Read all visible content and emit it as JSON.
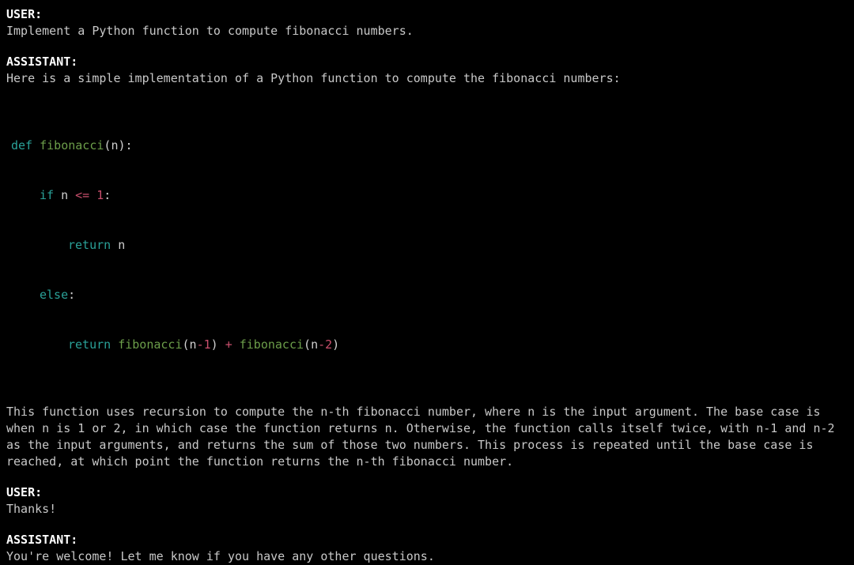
{
  "turns": [
    {
      "speaker": "USER:",
      "text": "Implement a Python function to compute fibonacci numbers."
    },
    {
      "speaker": "ASSISTANT:",
      "text": "Here is a simple implementation of a Python function to compute the fibonacci numbers:"
    }
  ],
  "code": {
    "line1": {
      "def": "def ",
      "fn": "fibonacci",
      "open": "(",
      "arg": "n",
      "close": "):"
    },
    "line2": {
      "if": "if ",
      "var": "n ",
      "op": "<= ",
      "num": "1",
      "colon": ":"
    },
    "line3": {
      "ret": "return ",
      "var": "n"
    },
    "line4": {
      "else": "else",
      "colon": ":"
    },
    "line5": {
      "ret": "return ",
      "fn1": "fibonacci",
      "open1": "(",
      "arg1": "n",
      "minus1": "-",
      "num1": "1",
      "close1": ") ",
      "plus": "+ ",
      "fn2": "fibonacci",
      "open2": "(",
      "arg2": "n",
      "minus2": "-",
      "num2": "2",
      "close2": ")"
    }
  },
  "explanation": "This function uses recursion to compute the n-th fibonacci number, where n is the input argument. The base case is when n is 1 or 2, in which case the function returns n. Otherwise, the function calls itself twice, with n-1 and n-2 as the input arguments, and returns the sum of those two numbers. This process is repeated until the base case is reached, at which point the function returns the n-th fibonacci number.",
  "turns2": [
    {
      "speaker": "USER:",
      "text": "Thanks!"
    },
    {
      "speaker": "ASSISTANT:",
      "text": "You're welcome! Let me know if you have any other questions."
    }
  ]
}
